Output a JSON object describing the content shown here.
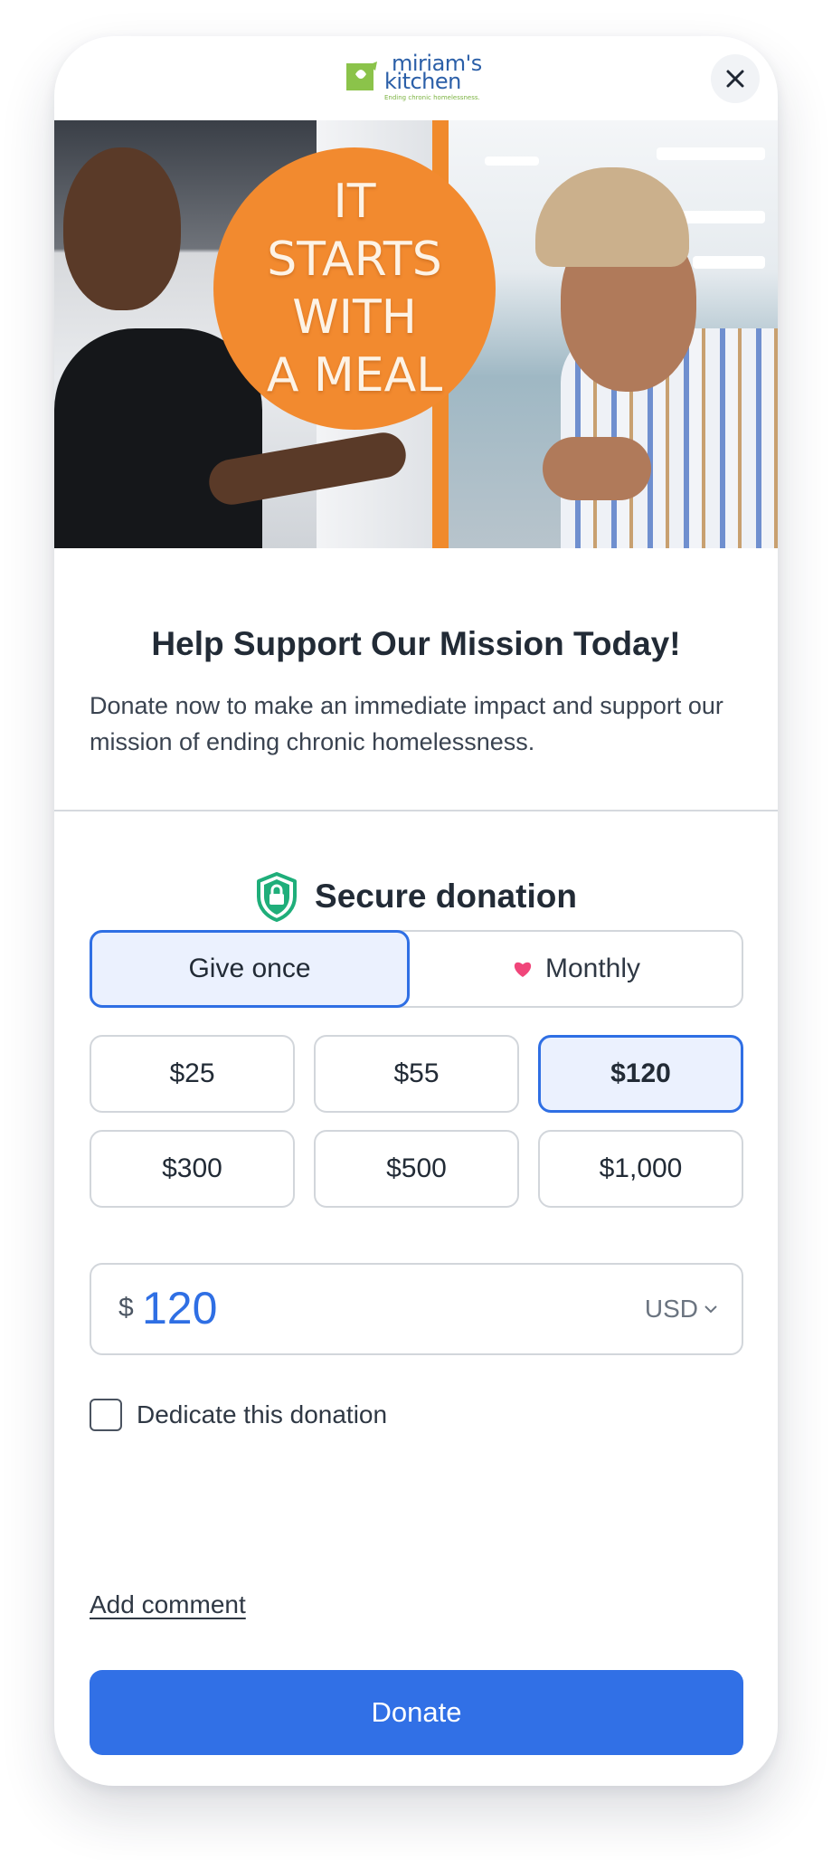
{
  "header": {
    "logo": {
      "line1": "miriam's",
      "line2": "kitchen",
      "tagline": "Ending chronic homelessness."
    },
    "close_icon": "close-icon"
  },
  "hero": {
    "text": "IT\nSTARTS\nWITH\nA MEAL"
  },
  "main": {
    "title": "Help Support Our Mission Today!",
    "description": "Donate now to make an immediate impact and support our mission of ending chronic homelessness."
  },
  "donation": {
    "secure_label": "Secure donation",
    "secure_icon": "shield-lock-icon",
    "frequency": {
      "once_label": "Give once",
      "monthly_label": "Monthly",
      "monthly_icon": "heart-icon",
      "selected": "once"
    },
    "amounts": [
      "$25",
      "$55",
      "$120",
      "$300",
      "$500",
      "$1,000"
    ],
    "selected_amount": "$120",
    "input": {
      "symbol": "$",
      "value": "120",
      "currency": "USD"
    },
    "dedicate_label": "Dedicate this donation",
    "dedicate_checked": false,
    "comment_link": "Add comment",
    "donate_label": "Donate"
  },
  "colors": {
    "accent": "#3170e6",
    "selected_bg": "#ebf1fe",
    "shield": "#1fae7a",
    "heart": "#f0467a",
    "hero_orange": "#f28a2f"
  }
}
